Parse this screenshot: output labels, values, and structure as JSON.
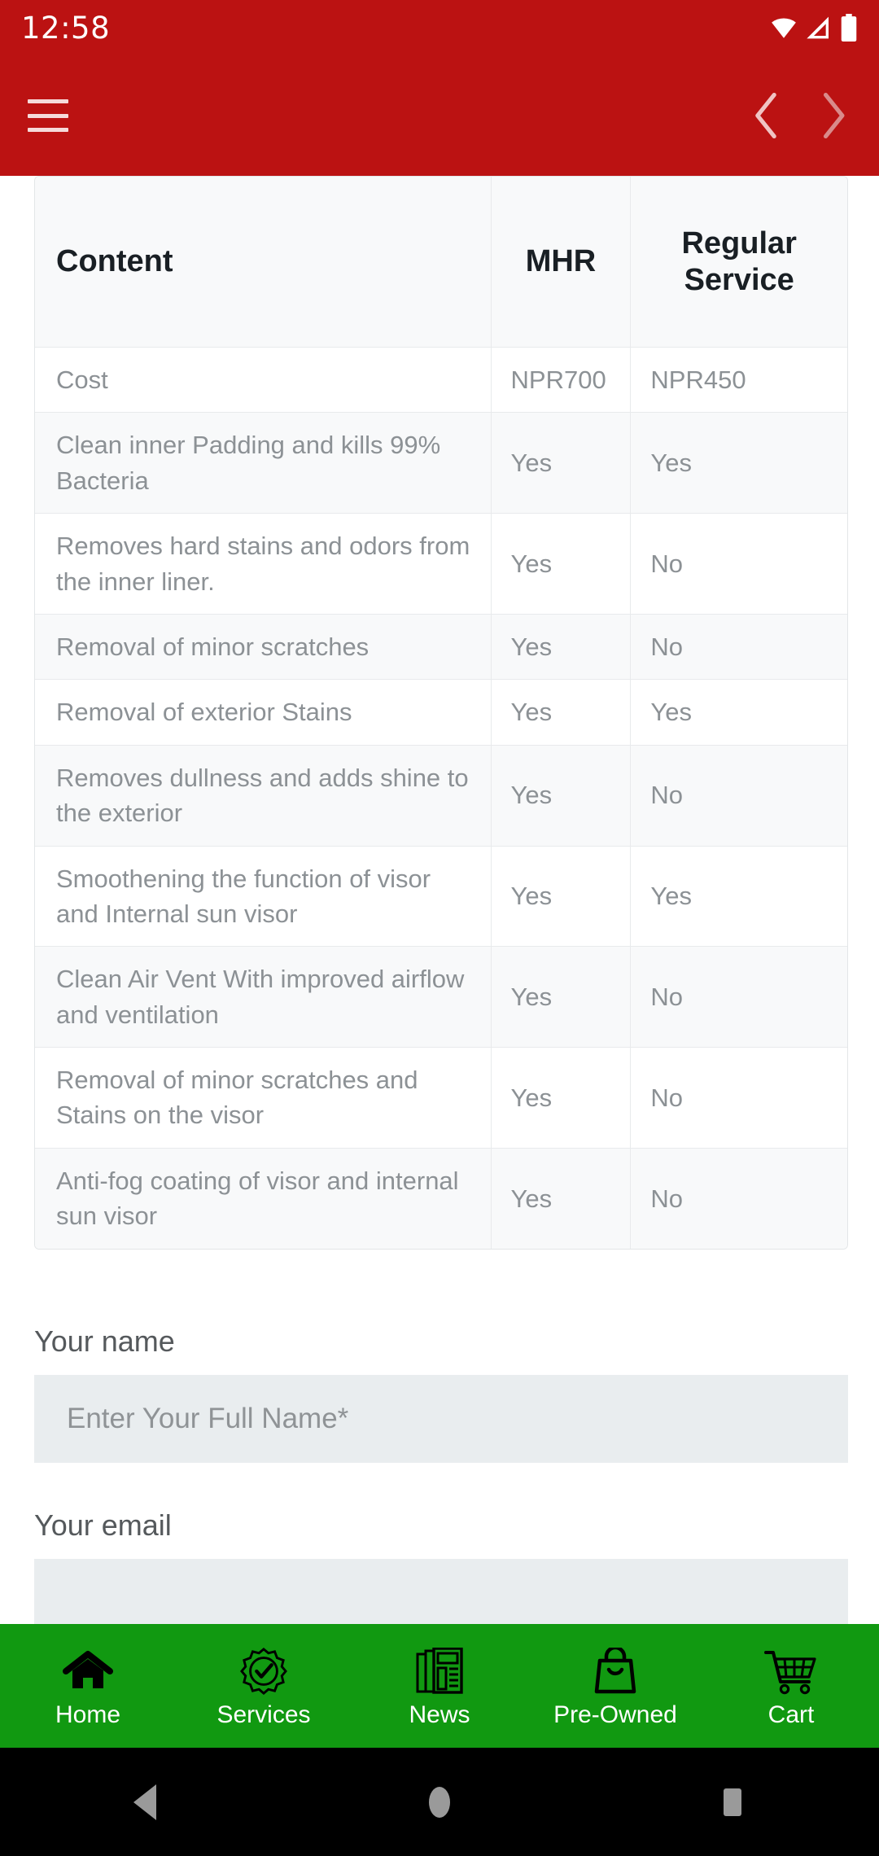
{
  "status_bar": {
    "time": "12:58",
    "icons": [
      "wifi-icon",
      "cellular-signal-icon",
      "battery-icon"
    ]
  },
  "app_bar": {
    "menu_icon": "hamburger-menu-icon",
    "back_icon": "chevron-left-icon",
    "forward_icon": "chevron-right-icon",
    "background_color": "#BB1212"
  },
  "table": {
    "headers": {
      "content": "Content",
      "mhr": "MHR",
      "regular": "Regular Service"
    },
    "rows": [
      {
        "label": "Cost",
        "mhr": "NPR700",
        "regular": "NPR450"
      },
      {
        "label": "Clean inner Padding and kills 99% Bacteria",
        "mhr": "Yes",
        "regular": "Yes"
      },
      {
        "label": "Removes hard stains and odors from the inner liner.",
        "mhr": "Yes",
        "regular": "No"
      },
      {
        "label": "Removal of minor scratches",
        "mhr": "Yes",
        "regular": "No"
      },
      {
        "label": "Removal of exterior Stains",
        "mhr": "Yes",
        "regular": "Yes"
      },
      {
        "label": "Removes dullness and adds shine to the exterior",
        "mhr": "Yes",
        "regular": "No"
      },
      {
        "label": "Smoothening the function of visor and Internal sun visor",
        "mhr": "Yes",
        "regular": "Yes"
      },
      {
        "label": "Clean Air Vent With improved airflow and ventilation",
        "mhr": "Yes",
        "regular": "No"
      },
      {
        "label": "Removal of minor scratches and Stains on the visor",
        "mhr": "Yes",
        "regular": "No"
      },
      {
        "label": "Anti-fog coating of visor and internal sun visor",
        "mhr": "Yes",
        "regular": "No"
      }
    ]
  },
  "form": {
    "name_label": "Your name",
    "name_placeholder": "Enter Your Full Name*",
    "name_value": "",
    "email_label": "Your email",
    "email_placeholder": "",
    "email_value": ""
  },
  "bottom_nav": {
    "background_color": "#119911",
    "items": [
      {
        "label": "Home",
        "icon": "home-icon"
      },
      {
        "label": "Services",
        "icon": "badge-check-icon"
      },
      {
        "label": "News",
        "icon": "newspaper-icon"
      },
      {
        "label": "Pre-Owned",
        "icon": "shopping-bag-icon"
      },
      {
        "label": "Cart",
        "icon": "shopping-cart-icon"
      }
    ]
  },
  "system_nav": {
    "back": "back-triangle-icon",
    "home": "home-circle-icon",
    "recents": "recents-square-icon"
  }
}
